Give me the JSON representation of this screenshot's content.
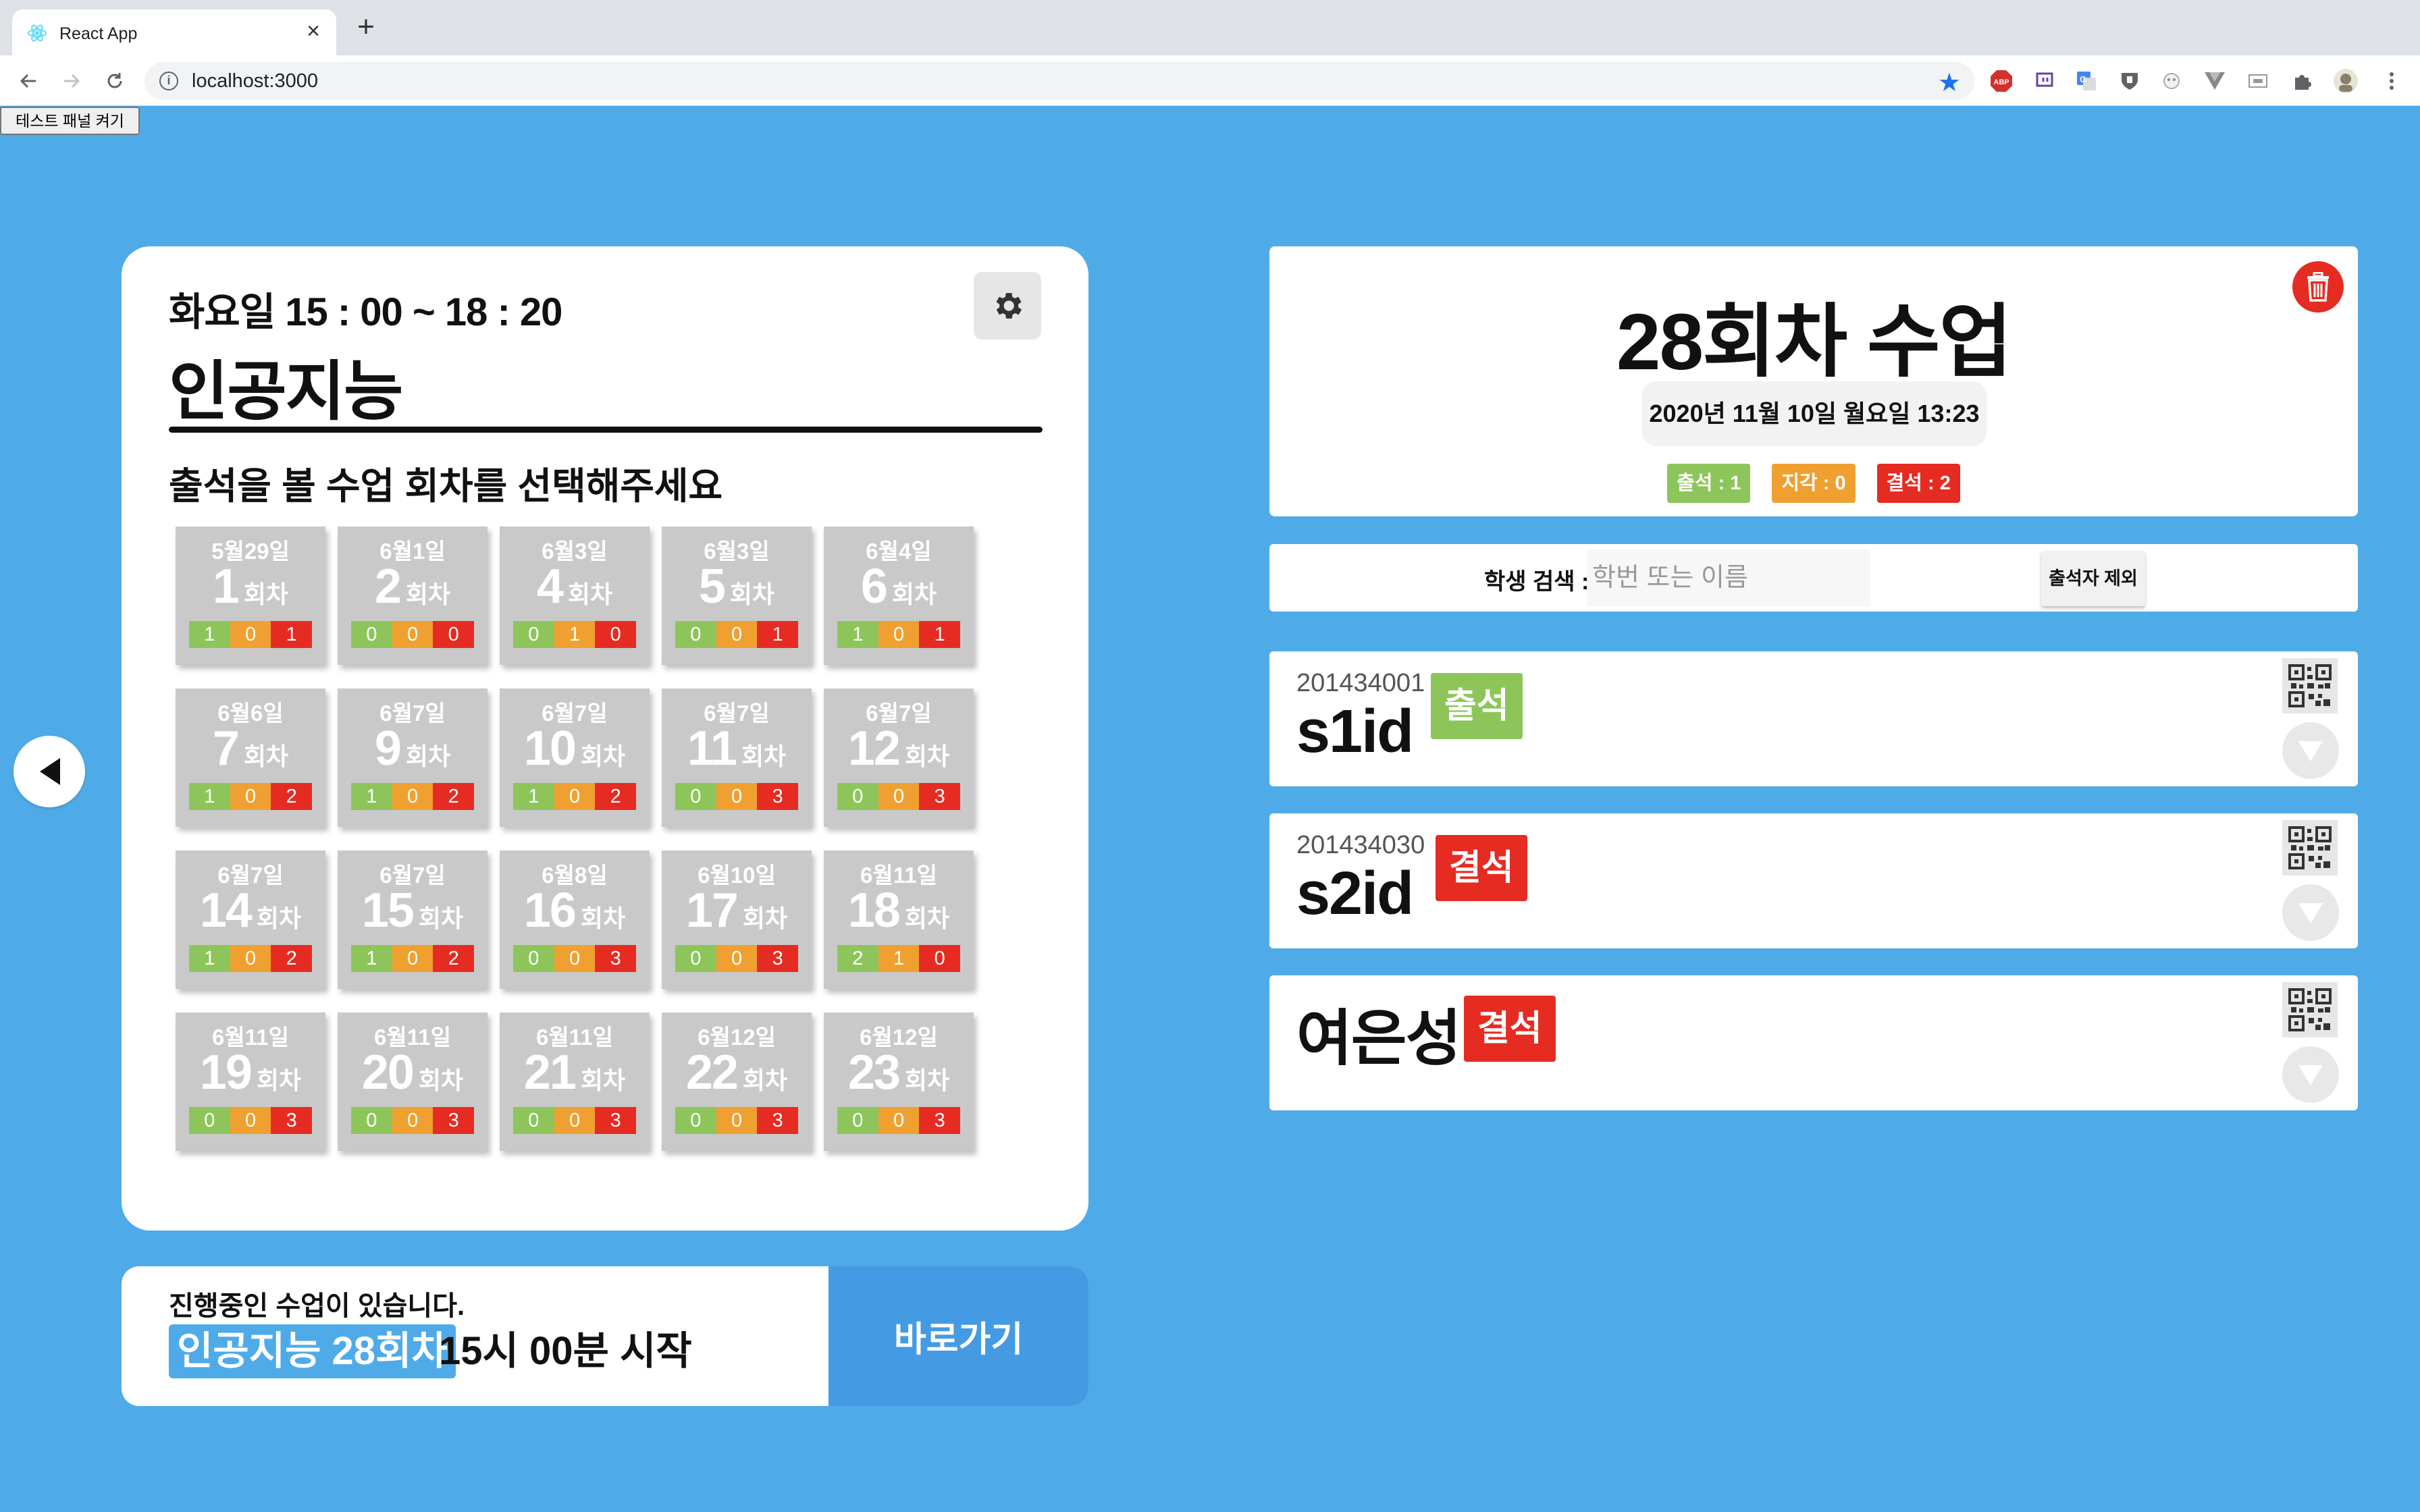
{
  "browser": {
    "tab_title": "React App",
    "tab_close": "×",
    "new_tab": "+",
    "url": "localhost:3000",
    "extensions": [
      "abp-icon",
      "twitch-icon",
      "translate-icon",
      "shield-icon",
      "ghost-icon",
      "vue-devtools-icon",
      "cast-icon",
      "puzzle-icon",
      "avatar-icon",
      "menu-icon"
    ]
  },
  "test_panel_button": "테스트 패널 켜기",
  "course": {
    "time": "화요일 15 : 00 ~ 18 : 20",
    "title": "인공지능",
    "prompt": "출석을 볼 수업 회차를 선택해주세요",
    "session_suffix": "회차",
    "sessions": [
      {
        "date": "5월29일",
        "num": "1",
        "present": "1",
        "late": "0",
        "absent": "1"
      },
      {
        "date": "6월1일",
        "num": "2",
        "present": "0",
        "late": "0",
        "absent": "0"
      },
      {
        "date": "6월3일",
        "num": "4",
        "present": "0",
        "late": "1",
        "absent": "0"
      },
      {
        "date": "6월3일",
        "num": "5",
        "present": "0",
        "late": "0",
        "absent": "1"
      },
      {
        "date": "6월4일",
        "num": "6",
        "present": "1",
        "late": "0",
        "absent": "1"
      },
      {
        "date": "6월6일",
        "num": "7",
        "present": "1",
        "late": "0",
        "absent": "2"
      },
      {
        "date": "6월7일",
        "num": "9",
        "present": "1",
        "late": "0",
        "absent": "2"
      },
      {
        "date": "6월7일",
        "num": "10",
        "present": "1",
        "late": "0",
        "absent": "2"
      },
      {
        "date": "6월7일",
        "num": "11",
        "present": "0",
        "late": "0",
        "absent": "3"
      },
      {
        "date": "6월7일",
        "num": "12",
        "present": "0",
        "late": "0",
        "absent": "3"
      },
      {
        "date": "6월7일",
        "num": "14",
        "present": "1",
        "late": "0",
        "absent": "2"
      },
      {
        "date": "6월7일",
        "num": "15",
        "present": "1",
        "late": "0",
        "absent": "2"
      },
      {
        "date": "6월8일",
        "num": "16",
        "present": "0",
        "late": "0",
        "absent": "3"
      },
      {
        "date": "6월10일",
        "num": "17",
        "present": "0",
        "late": "0",
        "absent": "3"
      },
      {
        "date": "6월11일",
        "num": "18",
        "present": "2",
        "late": "1",
        "absent": "0"
      },
      {
        "date": "6월11일",
        "num": "19",
        "present": "0",
        "late": "0",
        "absent": "3"
      },
      {
        "date": "6월11일",
        "num": "20",
        "present": "0",
        "late": "0",
        "absent": "3"
      },
      {
        "date": "6월11일",
        "num": "21",
        "present": "0",
        "late": "0",
        "absent": "3"
      },
      {
        "date": "6월12일",
        "num": "22",
        "present": "0",
        "late": "0",
        "absent": "3"
      },
      {
        "date": "6월12일",
        "num": "23",
        "present": "0",
        "late": "0",
        "absent": "3"
      }
    ]
  },
  "ongoing": {
    "message": "진행중인 수업이 있습니다.",
    "highlight": "인공지능 28회차",
    "start": "15시 00분 시작",
    "go_button": "바로가기"
  },
  "session_detail": {
    "title": "28회차 수업",
    "datetime": "2020년 11월 10일 월요일 13:23",
    "present_badge": "출석 : 1",
    "late_badge": "지각 : 0",
    "absent_badge": "결석 : 2"
  },
  "search": {
    "label": "학생 검색 :",
    "placeholder": "학번 또는 이름",
    "exclude_button": "출석자 제외"
  },
  "students": [
    {
      "id": "201434001",
      "name": "s1id",
      "status": "출석"
    },
    {
      "id": "201434030",
      "name": "s2id",
      "status": "결석"
    },
    {
      "id": "",
      "name": "여은성",
      "status": "결석"
    }
  ],
  "colors": {
    "background": "#4fabe8",
    "present": "#8dc55b",
    "late": "#f0a030",
    "absent": "#e62b22",
    "go_button": "#449be4"
  }
}
